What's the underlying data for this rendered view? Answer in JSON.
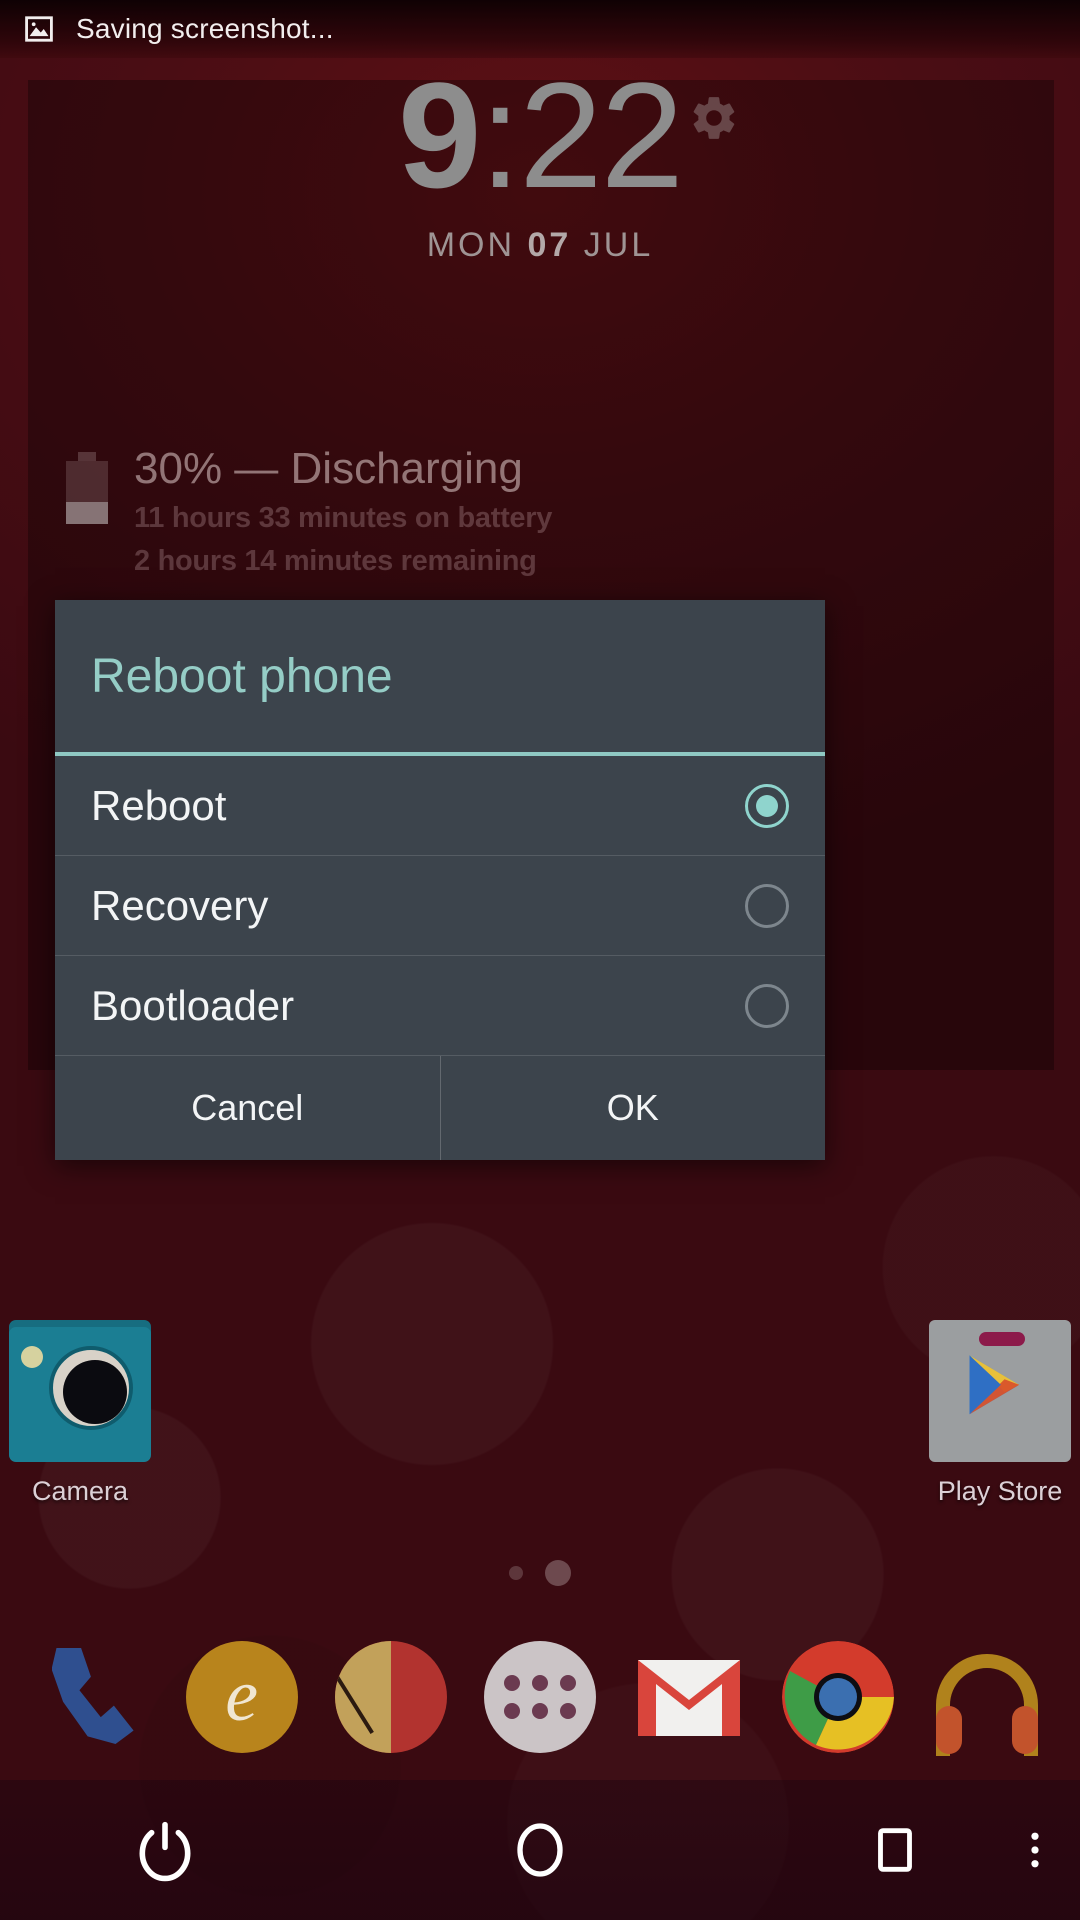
{
  "statusbar": {
    "icon": "image-icon",
    "text": "Saving screenshot..."
  },
  "clock_widget": {
    "hour": "9",
    "separator": ":",
    "minute": "22",
    "day_of_week": "MON",
    "day": "07",
    "month": "JUL",
    "gear_icon": "gear-icon"
  },
  "battery": {
    "icon": "battery-icon",
    "level_percent": "30%",
    "dash": "—",
    "status": "Discharging",
    "primary": "30% — Discharging",
    "line_on_battery": "11 hours 33 minutes on battery",
    "line_remaining": "2 hours 14 minutes remaining"
  },
  "dialog": {
    "title": "Reboot phone",
    "accent_color": "#8fc9c3",
    "background_color": "#3c444c",
    "options": [
      {
        "label": "Reboot",
        "selected": true
      },
      {
        "label": "Recovery",
        "selected": false
      },
      {
        "label": "Bootloader",
        "selected": false
      }
    ],
    "buttons": {
      "cancel": "Cancel",
      "ok": "OK"
    }
  },
  "home_screen": {
    "icons": [
      {
        "label": "Camera",
        "icon": "camera-icon"
      },
      {
        "label": "Play Store",
        "icon": "play-store-icon"
      }
    ],
    "page_indicator": {
      "pages": 2,
      "active_page": 2
    }
  },
  "dock": {
    "items": [
      {
        "icon": "phone-icon"
      },
      {
        "icon": "evernote-icon"
      },
      {
        "icon": "red-app-icon"
      },
      {
        "icon": "app-drawer-icon"
      },
      {
        "icon": "gmail-icon"
      },
      {
        "icon": "chrome-icon"
      },
      {
        "icon": "play-music-icon"
      }
    ]
  },
  "navbar": {
    "buttons": [
      {
        "icon": "power-icon"
      },
      {
        "icon": "home-icon"
      },
      {
        "icon": "recents-icon"
      },
      {
        "icon": "overflow-menu-icon"
      }
    ]
  }
}
